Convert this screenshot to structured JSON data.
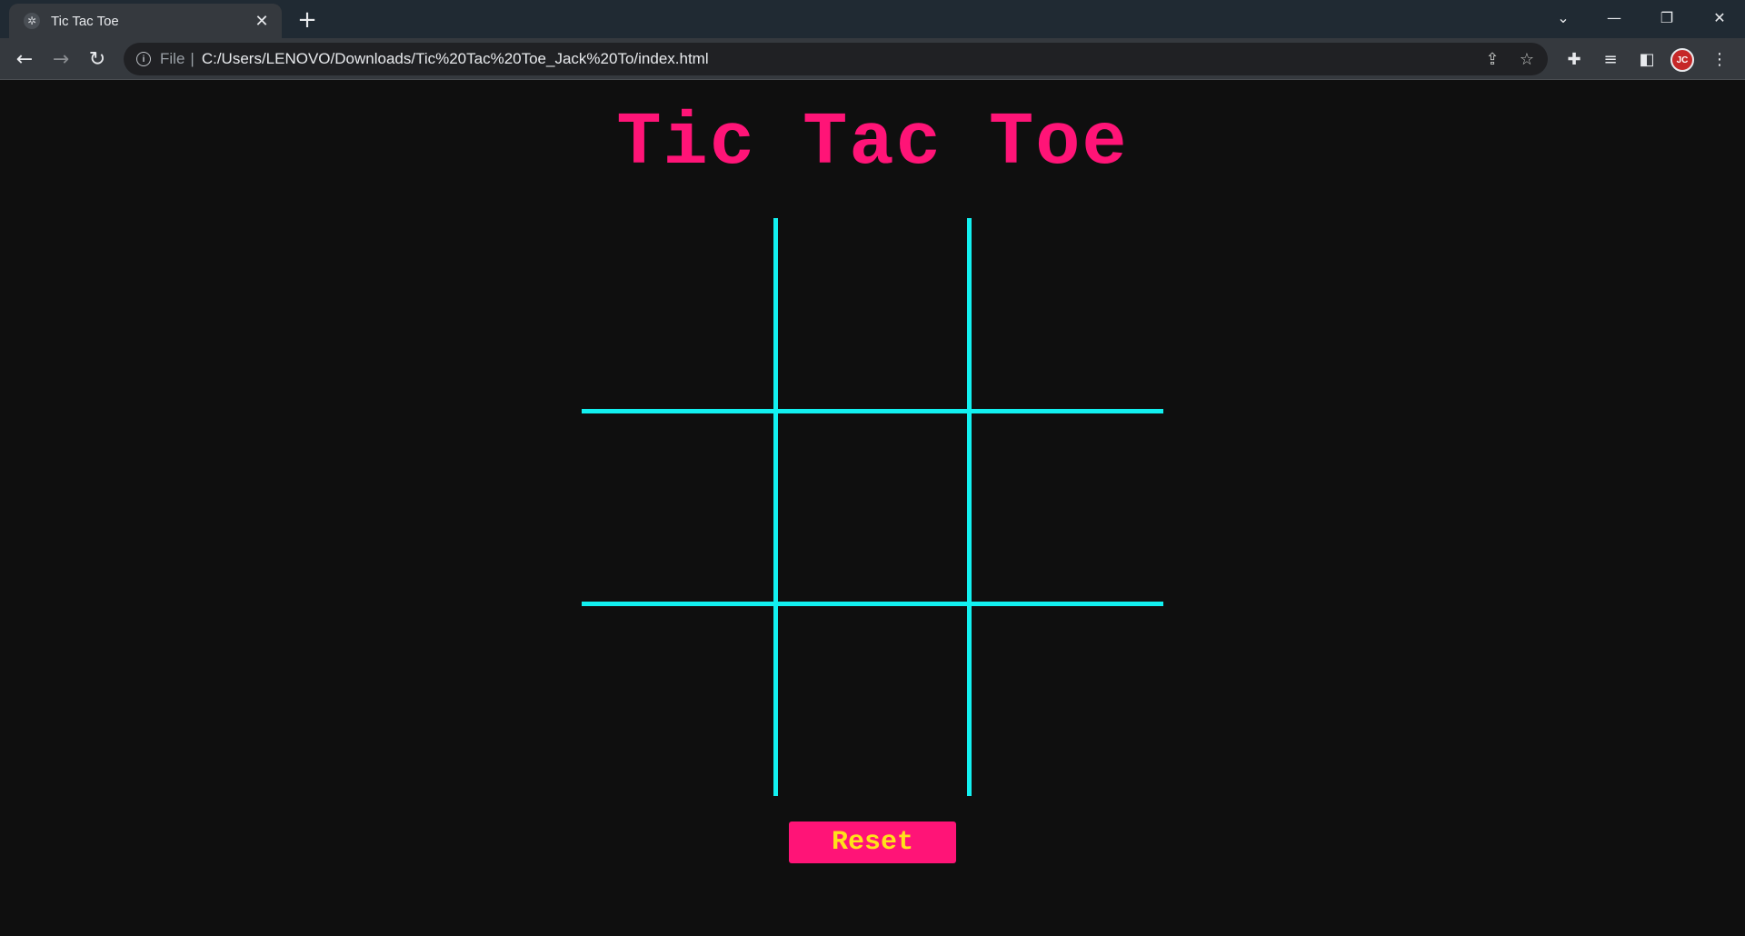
{
  "browser": {
    "tab_title": "Tic Tac Toe",
    "address_scheme": "File",
    "address_url": "C:/Users/LENOVO/Downloads/Tic%20Tac%20Toe_Jack%20To/index.html"
  },
  "game": {
    "title": "Tic Tac Toe",
    "reset_label": "Reset",
    "cells": [
      "",
      "",
      "",
      "",
      "",
      "",
      "",
      "",
      ""
    ]
  },
  "colors": {
    "title": "#ff1477",
    "grid_lines": "#12f0f0",
    "reset_background": "#ff1477",
    "reset_text": "#ffe11a",
    "page_background": "#0f0f0f"
  }
}
